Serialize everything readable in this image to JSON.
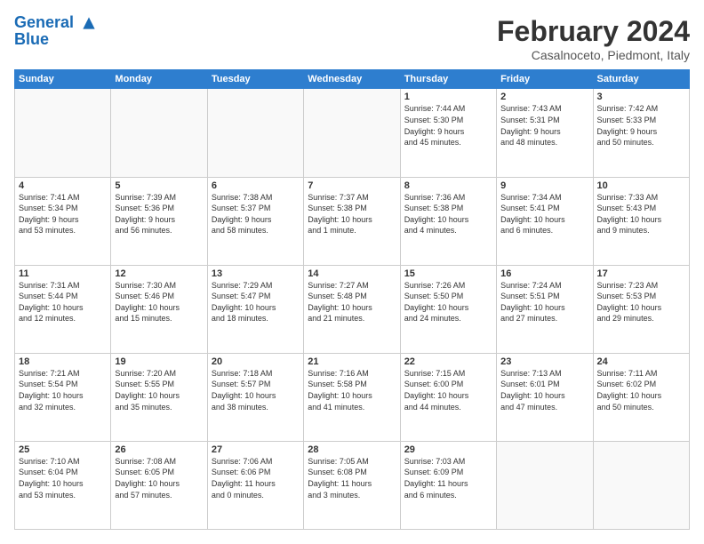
{
  "header": {
    "logo_line1": "General",
    "logo_line2": "Blue",
    "title": "February 2024",
    "subtitle": "Casalnoceto, Piedmont, Italy"
  },
  "days_of_week": [
    "Sunday",
    "Monday",
    "Tuesday",
    "Wednesday",
    "Thursday",
    "Friday",
    "Saturday"
  ],
  "weeks": [
    [
      {
        "day": "",
        "info": ""
      },
      {
        "day": "",
        "info": ""
      },
      {
        "day": "",
        "info": ""
      },
      {
        "day": "",
        "info": ""
      },
      {
        "day": "1",
        "info": "Sunrise: 7:44 AM\nSunset: 5:30 PM\nDaylight: 9 hours\nand 45 minutes."
      },
      {
        "day": "2",
        "info": "Sunrise: 7:43 AM\nSunset: 5:31 PM\nDaylight: 9 hours\nand 48 minutes."
      },
      {
        "day": "3",
        "info": "Sunrise: 7:42 AM\nSunset: 5:33 PM\nDaylight: 9 hours\nand 50 minutes."
      }
    ],
    [
      {
        "day": "4",
        "info": "Sunrise: 7:41 AM\nSunset: 5:34 PM\nDaylight: 9 hours\nand 53 minutes."
      },
      {
        "day": "5",
        "info": "Sunrise: 7:39 AM\nSunset: 5:36 PM\nDaylight: 9 hours\nand 56 minutes."
      },
      {
        "day": "6",
        "info": "Sunrise: 7:38 AM\nSunset: 5:37 PM\nDaylight: 9 hours\nand 58 minutes."
      },
      {
        "day": "7",
        "info": "Sunrise: 7:37 AM\nSunset: 5:38 PM\nDaylight: 10 hours\nand 1 minute."
      },
      {
        "day": "8",
        "info": "Sunrise: 7:36 AM\nSunset: 5:38 PM\nDaylight: 10 hours\nand 4 minutes."
      },
      {
        "day": "9",
        "info": "Sunrise: 7:34 AM\nSunset: 5:41 PM\nDaylight: 10 hours\nand 6 minutes."
      },
      {
        "day": "10",
        "info": "Sunrise: 7:33 AM\nSunset: 5:43 PM\nDaylight: 10 hours\nand 9 minutes."
      }
    ],
    [
      {
        "day": "11",
        "info": "Sunrise: 7:31 AM\nSunset: 5:44 PM\nDaylight: 10 hours\nand 12 minutes."
      },
      {
        "day": "12",
        "info": "Sunrise: 7:30 AM\nSunset: 5:46 PM\nDaylight: 10 hours\nand 15 minutes."
      },
      {
        "day": "13",
        "info": "Sunrise: 7:29 AM\nSunset: 5:47 PM\nDaylight: 10 hours\nand 18 minutes."
      },
      {
        "day": "14",
        "info": "Sunrise: 7:27 AM\nSunset: 5:48 PM\nDaylight: 10 hours\nand 21 minutes."
      },
      {
        "day": "15",
        "info": "Sunrise: 7:26 AM\nSunset: 5:50 PM\nDaylight: 10 hours\nand 24 minutes."
      },
      {
        "day": "16",
        "info": "Sunrise: 7:24 AM\nSunset: 5:51 PM\nDaylight: 10 hours\nand 27 minutes."
      },
      {
        "day": "17",
        "info": "Sunrise: 7:23 AM\nSunset: 5:53 PM\nDaylight: 10 hours\nand 29 minutes."
      }
    ],
    [
      {
        "day": "18",
        "info": "Sunrise: 7:21 AM\nSunset: 5:54 PM\nDaylight: 10 hours\nand 32 minutes."
      },
      {
        "day": "19",
        "info": "Sunrise: 7:20 AM\nSunset: 5:55 PM\nDaylight: 10 hours\nand 35 minutes."
      },
      {
        "day": "20",
        "info": "Sunrise: 7:18 AM\nSunset: 5:57 PM\nDaylight: 10 hours\nand 38 minutes."
      },
      {
        "day": "21",
        "info": "Sunrise: 7:16 AM\nSunset: 5:58 PM\nDaylight: 10 hours\nand 41 minutes."
      },
      {
        "day": "22",
        "info": "Sunrise: 7:15 AM\nSunset: 6:00 PM\nDaylight: 10 hours\nand 44 minutes."
      },
      {
        "day": "23",
        "info": "Sunrise: 7:13 AM\nSunset: 6:01 PM\nDaylight: 10 hours\nand 47 minutes."
      },
      {
        "day": "24",
        "info": "Sunrise: 7:11 AM\nSunset: 6:02 PM\nDaylight: 10 hours\nand 50 minutes."
      }
    ],
    [
      {
        "day": "25",
        "info": "Sunrise: 7:10 AM\nSunset: 6:04 PM\nDaylight: 10 hours\nand 53 minutes."
      },
      {
        "day": "26",
        "info": "Sunrise: 7:08 AM\nSunset: 6:05 PM\nDaylight: 10 hours\nand 57 minutes."
      },
      {
        "day": "27",
        "info": "Sunrise: 7:06 AM\nSunset: 6:06 PM\nDaylight: 11 hours\nand 0 minutes."
      },
      {
        "day": "28",
        "info": "Sunrise: 7:05 AM\nSunset: 6:08 PM\nDaylight: 11 hours\nand 3 minutes."
      },
      {
        "day": "29",
        "info": "Sunrise: 7:03 AM\nSunset: 6:09 PM\nDaylight: 11 hours\nand 6 minutes."
      },
      {
        "day": "",
        "info": ""
      },
      {
        "day": "",
        "info": ""
      }
    ]
  ]
}
